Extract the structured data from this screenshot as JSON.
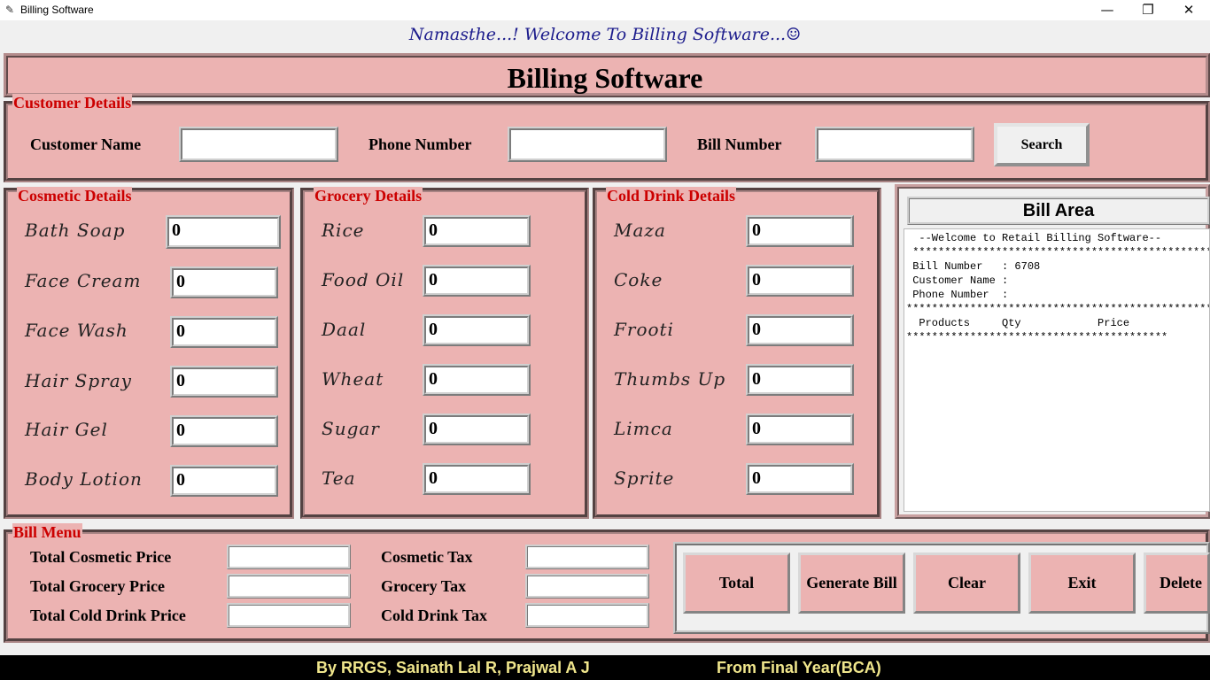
{
  "window": {
    "title": "Billing Software",
    "icon": "feather-icon",
    "minimize": "—",
    "restore": "❐",
    "close": "✕"
  },
  "welcome": "Namasthe...! Welcome To Billing Software...☺",
  "header_title": "Billing Software",
  "customer": {
    "label": "Customer Details",
    "name_label": "Customer Name",
    "phone_label": "Phone Number",
    "bill_label": "Bill Number",
    "name_value": "",
    "phone_value": "",
    "bill_value": "",
    "search_label": "Search"
  },
  "cosmetic": {
    "label": "Cosmetic Details",
    "items": [
      {
        "name": "Bath Soap",
        "qty": "0"
      },
      {
        "name": "Face Cream",
        "qty": "0"
      },
      {
        "name": "Face Wash",
        "qty": "0"
      },
      {
        "name": "Hair Spray",
        "qty": "0"
      },
      {
        "name": "Hair Gel",
        "qty": "0"
      },
      {
        "name": "Body Lotion",
        "qty": "0"
      }
    ]
  },
  "grocery": {
    "label": "Grocery Details",
    "items": [
      {
        "name": "Rice",
        "qty": "0"
      },
      {
        "name": "Food Oil",
        "qty": "0"
      },
      {
        "name": "Daal",
        "qty": "0"
      },
      {
        "name": "Wheat",
        "qty": "0"
      },
      {
        "name": "Sugar",
        "qty": "0"
      },
      {
        "name": "Tea",
        "qty": "0"
      }
    ]
  },
  "colddrink": {
    "label": "Cold Drink Details",
    "items": [
      {
        "name": "Maza",
        "qty": "0"
      },
      {
        "name": "Coke",
        "qty": "0"
      },
      {
        "name": "Frooti",
        "qty": "0"
      },
      {
        "name": "Thumbs Up",
        "qty": "0"
      },
      {
        "name": "Limca",
        "qty": "0"
      },
      {
        "name": "Sprite",
        "qty": "0"
      }
    ]
  },
  "bill_area": {
    "title": "Bill Area",
    "lines": [
      "  --Welcome to Retail Billing Software--",
      " ***************************************************",
      "",
      " Bill Number   : 6708",
      " Customer Name :",
      " Phone Number  :",
      "******************************************************",
      "",
      "  Products     Qty            Price",
      "*****************************************"
    ]
  },
  "bill_menu": {
    "label": "Bill Menu",
    "total_cosmetic_label": "Total Cosmetic Price",
    "total_grocery_label": "Total Grocery Price",
    "total_colddrink_label": "Total Cold Drink Price",
    "cosmetic_tax_label": "Cosmetic Tax",
    "grocery_tax_label": "Grocery Tax",
    "colddrink_tax_label": "Cold Drink Tax",
    "total_cosmetic_value": "",
    "total_grocery_value": "",
    "total_colddrink_value": "",
    "cosmetic_tax_value": "",
    "grocery_tax_value": "",
    "colddrink_tax_value": ""
  },
  "buttons": {
    "total": "Total",
    "generate": "Generate Bill",
    "clear": "Clear",
    "exit": "Exit",
    "delete": "Delete"
  },
  "footer": {
    "authors": "By RRGS, Sainath Lal R, Prajwal A J",
    "class": "From Final Year(BCA)"
  },
  "colors": {
    "panel_bg": "#ecb3b2",
    "label_red": "#cc0000",
    "welcome_blue": "#1c1c8c",
    "footer_text": "#f0e68c"
  }
}
